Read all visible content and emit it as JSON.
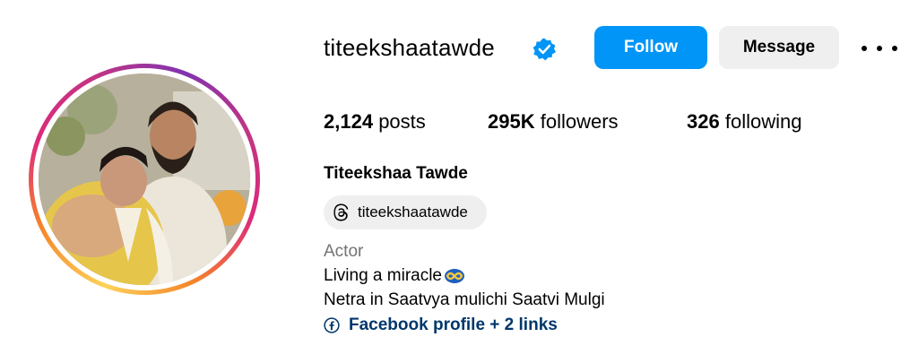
{
  "profile": {
    "username": "titeekshaatawde",
    "verified": true,
    "full_name": "Titeekshaa Tawde",
    "threads_handle": "titeekshaatawde",
    "category": "Actor",
    "bio_line1": "Living a miracle",
    "bio_line2": "Netra in Saatvya mulichi Saatvi Mulgi",
    "links_text": "Facebook profile + 2 links"
  },
  "actions": {
    "follow_label": "Follow",
    "message_label": "Message"
  },
  "stats": {
    "posts_count": "2,124",
    "posts_label": "posts",
    "followers_count": "295K",
    "followers_label": "followers",
    "following_count": "326",
    "following_label": "following"
  },
  "icons": {
    "verified": "verified-badge-icon",
    "more": "more-options-icon",
    "threads": "threads-icon",
    "facebook": "facebook-icon",
    "bio_emoji": "infinity-emoji-icon"
  },
  "colors": {
    "primary_button": "#0095f6",
    "secondary_button": "#efefef",
    "link": "#00376b",
    "muted": "#737373"
  }
}
